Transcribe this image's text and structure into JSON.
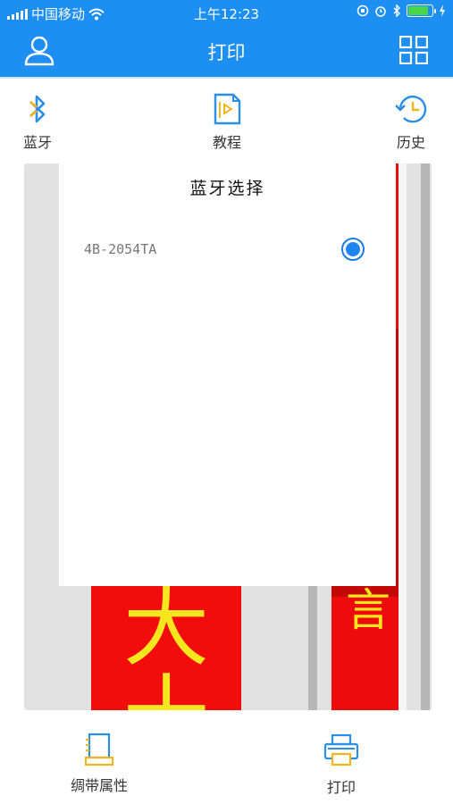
{
  "status_bar": {
    "carrier": "中国移动",
    "time": "上午12:23",
    "battery_color": "#4ad54a",
    "battery_fill_percent": 85
  },
  "header": {
    "title": "打印",
    "left_icon": "user-icon",
    "right_icon": "grid-icon",
    "background": "#1d8ff3"
  },
  "tools": [
    {
      "label": "蓝牙",
      "icon": "bluetooth-icon"
    },
    {
      "label": "教程",
      "icon": "tutorial-icon"
    },
    {
      "label": "历史",
      "icon": "history-icon"
    }
  ],
  "preview": {
    "ribbon_char_1": "大",
    "ribbon_char_1b": "十",
    "ribbon_char_2": "言"
  },
  "dialog": {
    "title": "蓝牙选择",
    "devices": [
      {
        "name": "4B-2054TA",
        "selected": true
      }
    ]
  },
  "bottom_bar": {
    "ribbon_properties_label": "绸带属性",
    "print_label": "打印"
  }
}
